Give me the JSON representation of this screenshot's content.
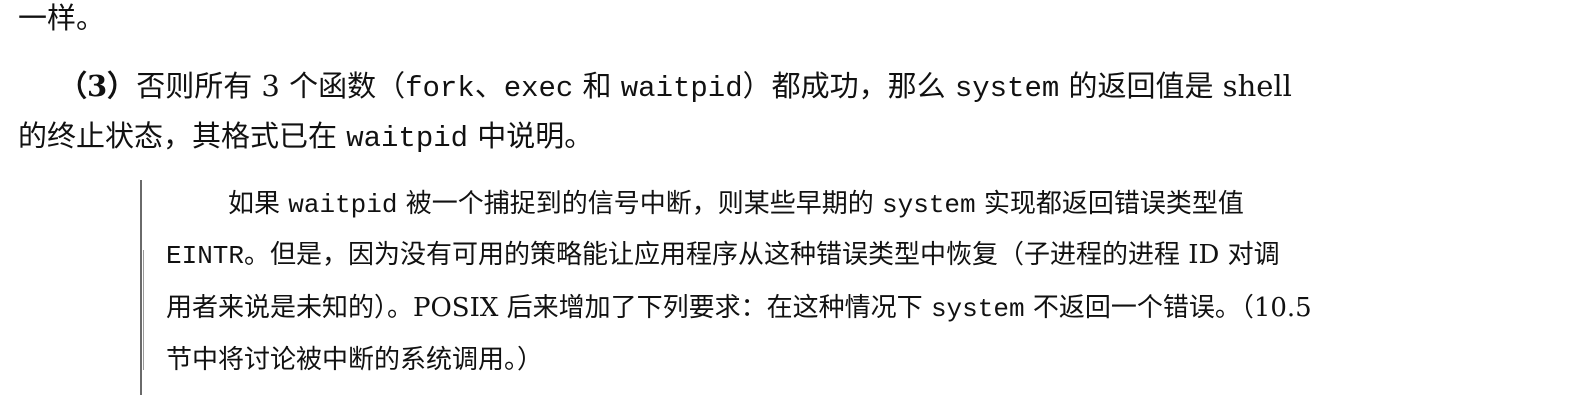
{
  "body": {
    "line1": "一样。",
    "para3": {
      "number": "（3）",
      "text_a": "否则所有 3 个函数（",
      "code_fork": "fork",
      "sep1": "、",
      "code_exec": "exec",
      "and": " 和 ",
      "code_waitpid": "waitpid",
      "text_b": "）都成功，那么 ",
      "code_system": "system",
      "text_c": " 的返回值是 shell",
      "line2_a": "的终止状态，其格式已在 ",
      "line2_code": "waitpid",
      "line2_b": " 中说明。"
    }
  },
  "note": {
    "l1_a": "如果 ",
    "l1_code1": "waitpid",
    "l1_b": " 被一个捕捉到的信号中断，则某些早期的 ",
    "l1_code2": "system",
    "l1_c": " 实现都返回错误类型值",
    "l2_code": "EINTR",
    "l2_text": "。但是，因为没有可用的策略能让应用程序从这种错误类型中恢复（子进程的进程 ID 对调",
    "l3_a": "用者来说是未知的）。POSIX 后来增加了下列要求：在这种情况下 ",
    "l3_code": "system",
    "l3_b": " 不返回一个错误。（10.5",
    "l4": "节中将讨论被中断的系统调用。）"
  }
}
